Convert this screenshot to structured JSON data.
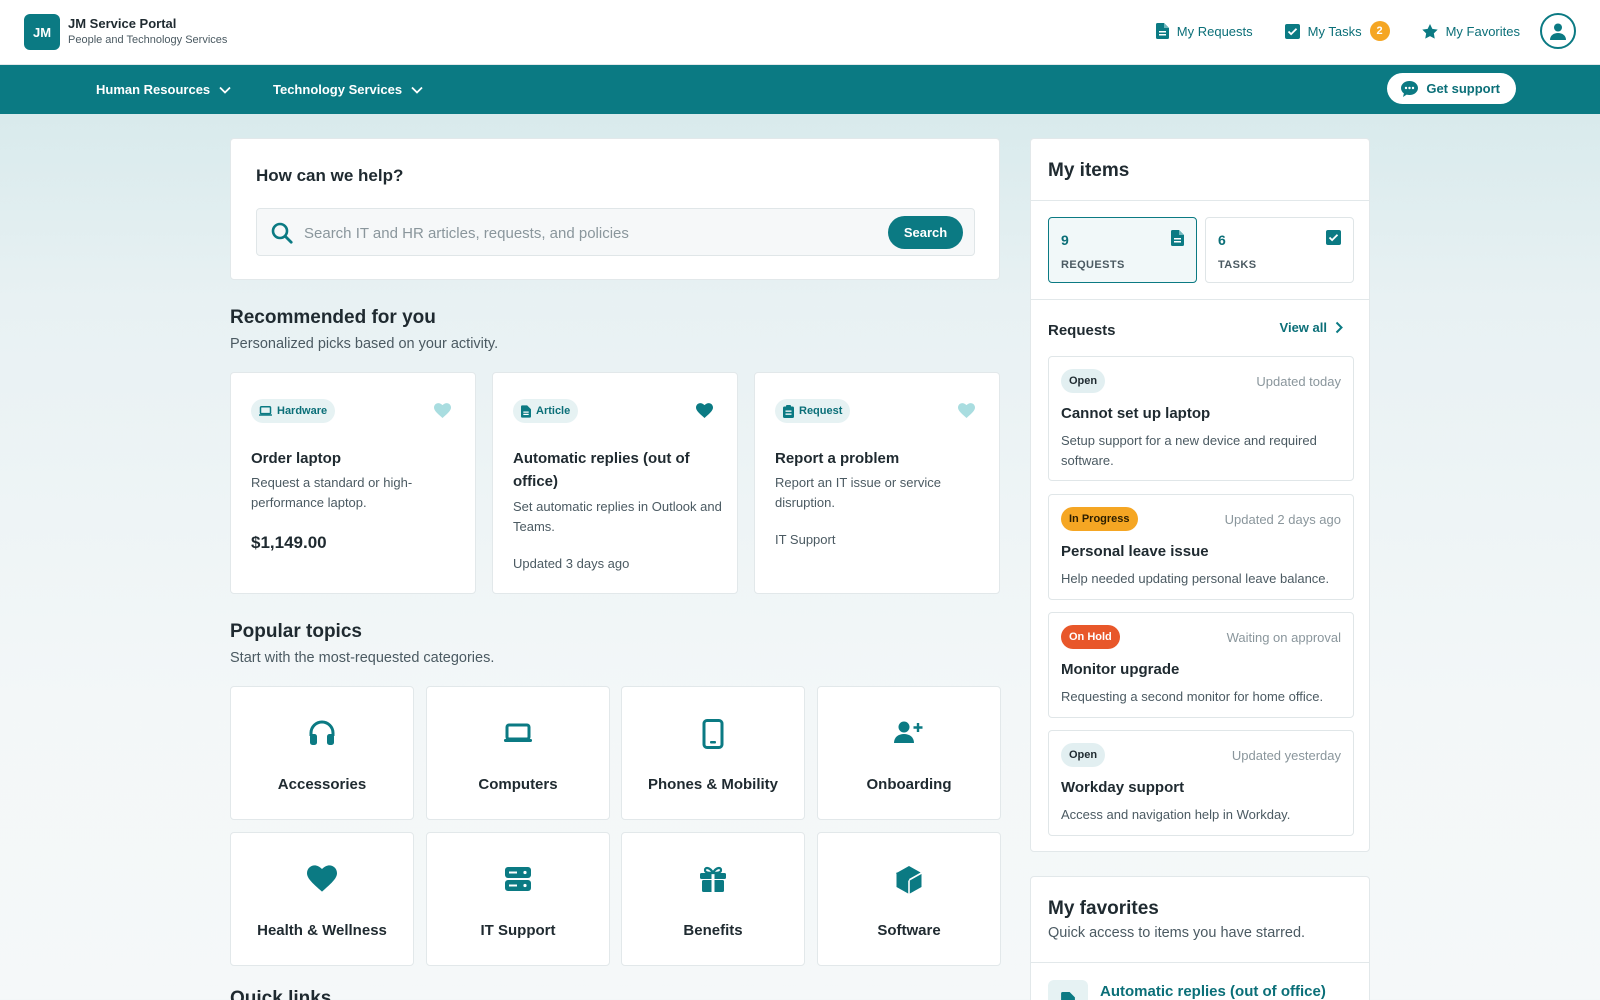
{
  "brand": {
    "logo_text": "JM",
    "title": "JM Service Portal",
    "subtitle": "People and Technology Services"
  },
  "topnav": {
    "my_requests": "My Requests",
    "my_tasks": "My Tasks",
    "my_tasks_count": "2",
    "my_favorites": "My Favorites"
  },
  "mainnav": {
    "human_resources": "Human Resources",
    "technology_services": "Technology Services",
    "get_support": "Get support"
  },
  "search": {
    "heading": "How can we help?",
    "placeholder": "Search IT and HR articles, requests, and policies",
    "value": "",
    "button": "Search"
  },
  "recommended": {
    "title": "Recommended for you",
    "subtitle": "Personalized picks based on your activity.",
    "cards": [
      {
        "tag": "Hardware",
        "tag_icon": "laptop-icon",
        "favorited": false,
        "title": "Order laptop",
        "description": "Request a standard or high-performance laptop.",
        "price": "$1,149.00"
      },
      {
        "tag": "Article",
        "tag_icon": "document-icon",
        "favorited": true,
        "title": "Automatic replies (out of office)",
        "description": "Set automatic replies in Outlook and Teams.",
        "meta": "Updated 3 days ago"
      },
      {
        "tag": "Request",
        "tag_icon": "clipboard-icon",
        "favorited": false,
        "title": "Report a problem",
        "description": "Report an IT issue or service disruption.",
        "meta": "IT Support"
      }
    ]
  },
  "topics": {
    "title": "Popular topics",
    "subtitle": "Start with the most-requested categories.",
    "items": [
      {
        "label": "Accessories",
        "icon": "headphones-icon"
      },
      {
        "label": "Computers",
        "icon": "laptop-icon"
      },
      {
        "label": "Phones & Mobility",
        "icon": "phone-icon"
      },
      {
        "label": "Onboarding",
        "icon": "add-user-icon"
      },
      {
        "label": "Health & Wellness",
        "icon": "heart-icon"
      },
      {
        "label": "IT Support",
        "icon": "server-icon"
      },
      {
        "label": "Benefits",
        "icon": "gift-icon"
      },
      {
        "label": "Software",
        "icon": "cube-icon"
      }
    ]
  },
  "quick_links": {
    "title": "Quick links"
  },
  "my_items": {
    "title": "My items",
    "requests_count": "9",
    "requests_label": "REQUESTS",
    "tasks_count": "6",
    "tasks_label": "TASKS",
    "requests_heading": "Requests",
    "view_all": "View all",
    "requests": [
      {
        "status": "Open",
        "status_kind": "open",
        "updated": "Updated today",
        "title": "Cannot set up laptop",
        "description": "Setup support for a new device and required software."
      },
      {
        "status": "In Progress",
        "status_kind": "progress",
        "updated": "Updated 2 days ago",
        "title": "Personal leave issue",
        "description": "Help needed updating personal leave balance."
      },
      {
        "status": "On Hold",
        "status_kind": "hold",
        "updated": "Waiting on approval",
        "title": "Monitor upgrade",
        "description": "Requesting a second monitor for home office."
      },
      {
        "status": "Open",
        "status_kind": "open",
        "updated": "Updated yesterday",
        "title": "Workday support",
        "description": "Access and navigation help in Workday."
      }
    ]
  },
  "favorites": {
    "title": "My favorites",
    "subtitle": "Quick access to items you have starred.",
    "items": [
      {
        "title": "Automatic replies (out of office)",
        "icon": "document-icon"
      }
    ]
  },
  "colors": {
    "primary": "#0b7a83",
    "primary_dark": "#0b6f78",
    "badge_orange": "#f5a623",
    "status_hold": "#e8572a",
    "heart_light": "#a9dde0"
  }
}
